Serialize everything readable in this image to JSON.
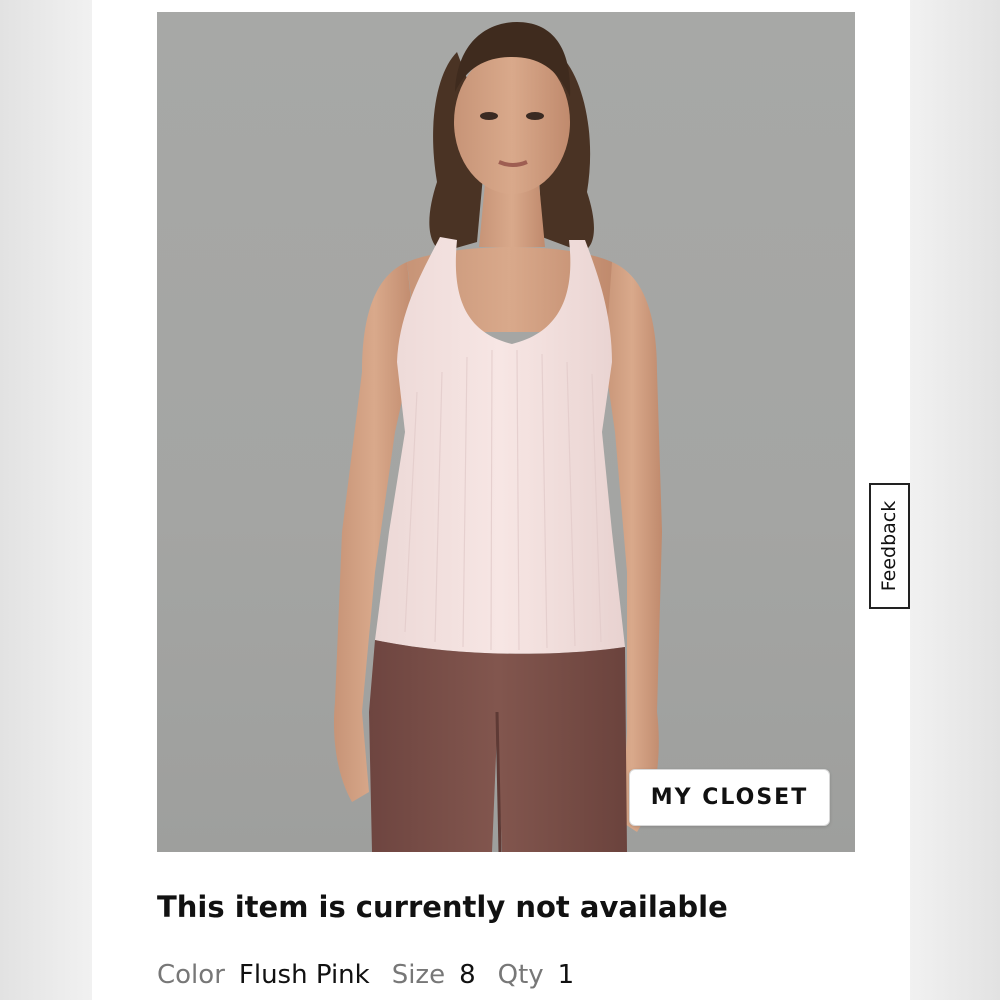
{
  "product": {
    "closet_button_label": "MY CLOSET",
    "feedback_label": "Feedback",
    "status_message": "This item is currently not available",
    "details": {
      "color_label": "Color",
      "color_value": "Flush Pink",
      "size_label": "Size",
      "size_value": "8",
      "qty_label": "Qty",
      "qty_value": "1"
    }
  },
  "colors": {
    "photo_background": "#a6a7a5",
    "tank_top": "#f3dede",
    "leggings": "#7a4e47",
    "text": "#111111",
    "muted_text": "#777777"
  }
}
